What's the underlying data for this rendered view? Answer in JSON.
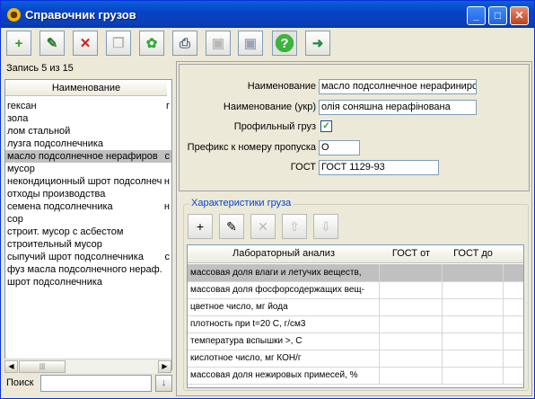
{
  "window": {
    "title": "Справочник грузов",
    "controls": [
      "_",
      "□",
      "✕"
    ]
  },
  "toolbar": [
    {
      "icon": "add-icon",
      "glyph": "+",
      "disabled": false,
      "color": "#2a9a2a"
    },
    {
      "icon": "edit-icon",
      "glyph": "✎",
      "disabled": false,
      "color": "#2a7a2a"
    },
    {
      "icon": "delete-icon",
      "glyph": "✕",
      "disabled": false,
      "color": "#d02020"
    },
    {
      "icon": "copy-icon",
      "glyph": "❐",
      "disabled": true,
      "color": "#b8b8b8"
    },
    {
      "icon": "settings-icon",
      "glyph": "✿",
      "disabled": false,
      "color": "#3aa83a"
    },
    {
      "icon": "print-icon",
      "glyph": "⎙",
      "disabled": false,
      "color": "#5a6a7a"
    },
    {
      "icon": "save-icon",
      "glyph": "▣",
      "disabled": true,
      "color": "#b8b8b8"
    },
    {
      "icon": "save-as-icon",
      "glyph": "▣",
      "disabled": true,
      "color": "#9aa4b4"
    },
    {
      "icon": "help-icon",
      "glyph": "?",
      "disabled": false,
      "color": "#ffffff"
    },
    {
      "icon": "exit-icon",
      "glyph": "➜",
      "disabled": false,
      "color": "#2a8a4a"
    }
  ],
  "left": {
    "record_label": "Запись 5 из 15",
    "list_header": "Наименование",
    "items": [
      {
        "name": "гексан",
        "extra": "г"
      },
      {
        "name": "зола",
        "extra": ""
      },
      {
        "name": "лом стальной",
        "extra": ""
      },
      {
        "name": "лузга подсолнечника",
        "extra": ""
      },
      {
        "name": "масло подсолнечное нерафиров",
        "extra": "с"
      },
      {
        "name": "мусор",
        "extra": ""
      },
      {
        "name": "некондиционный шрот подсолнеч",
        "extra": "н"
      },
      {
        "name": "отходы производства",
        "extra": ""
      },
      {
        "name": "семена подсолнечника",
        "extra": "н"
      },
      {
        "name": "сор",
        "extra": ""
      },
      {
        "name": "строит. мусор с асбестом",
        "extra": ""
      },
      {
        "name": "строительный мусор",
        "extra": ""
      },
      {
        "name": "сыпучий шрот подсолнечника",
        "extra": "с"
      },
      {
        "name": "фуз масла подсолнечного нераф.",
        "extra": ""
      },
      {
        "name": "шрот подсолнечника",
        "extra": ""
      }
    ],
    "selected_index": 4,
    "search_label": "Поиск",
    "search_value": ""
  },
  "form": {
    "name_label": "Наименование",
    "name_value": "масло подсолнечное нерафиниров",
    "name_ukr_label": "Наименование (укр)",
    "name_ukr_value": "олія соняшна нерафінована",
    "profile_label": "Профильный груз",
    "profile_checked": "✓",
    "prefix_label": "Префикс к номеру пропуска",
    "prefix_value": "О",
    "gost_label": "ГОСТ",
    "gost_value": "ГОСТ 1129-93"
  },
  "characteristics": {
    "title": "Характеристики груза",
    "tools": [
      {
        "icon": "add-row-icon",
        "glyph": "+",
        "disabled": false
      },
      {
        "icon": "edit-row-icon",
        "glyph": "✎",
        "disabled": false
      },
      {
        "icon": "delete-row-icon",
        "glyph": "✕",
        "disabled": true
      },
      {
        "icon": "move-up-icon",
        "glyph": "⇧",
        "disabled": true
      },
      {
        "icon": "move-down-icon",
        "glyph": "⇩",
        "disabled": true
      }
    ],
    "columns": [
      "Лабораторный анализ",
      "ГОСТ от",
      "ГОСТ до"
    ],
    "rows": [
      {
        "analysis": "массовая доля влаги и летучих веществ,",
        "from": "",
        "to": ""
      },
      {
        "analysis": "массовая доля фосфорсодержащих вещ-",
        "from": "",
        "to": ""
      },
      {
        "analysis": "цветное число, мг йода",
        "from": "",
        "to": ""
      },
      {
        "analysis": "плотность при t=20 С, г/см3",
        "from": "",
        "to": ""
      },
      {
        "analysis": "температура вспышки >, С",
        "from": "",
        "to": ""
      },
      {
        "analysis": "кислотное число, мг КОН/г",
        "from": "",
        "to": ""
      },
      {
        "analysis": "массовая доля нежировых примесей, %",
        "from": "",
        "to": ""
      }
    ],
    "selected_index": 0
  }
}
